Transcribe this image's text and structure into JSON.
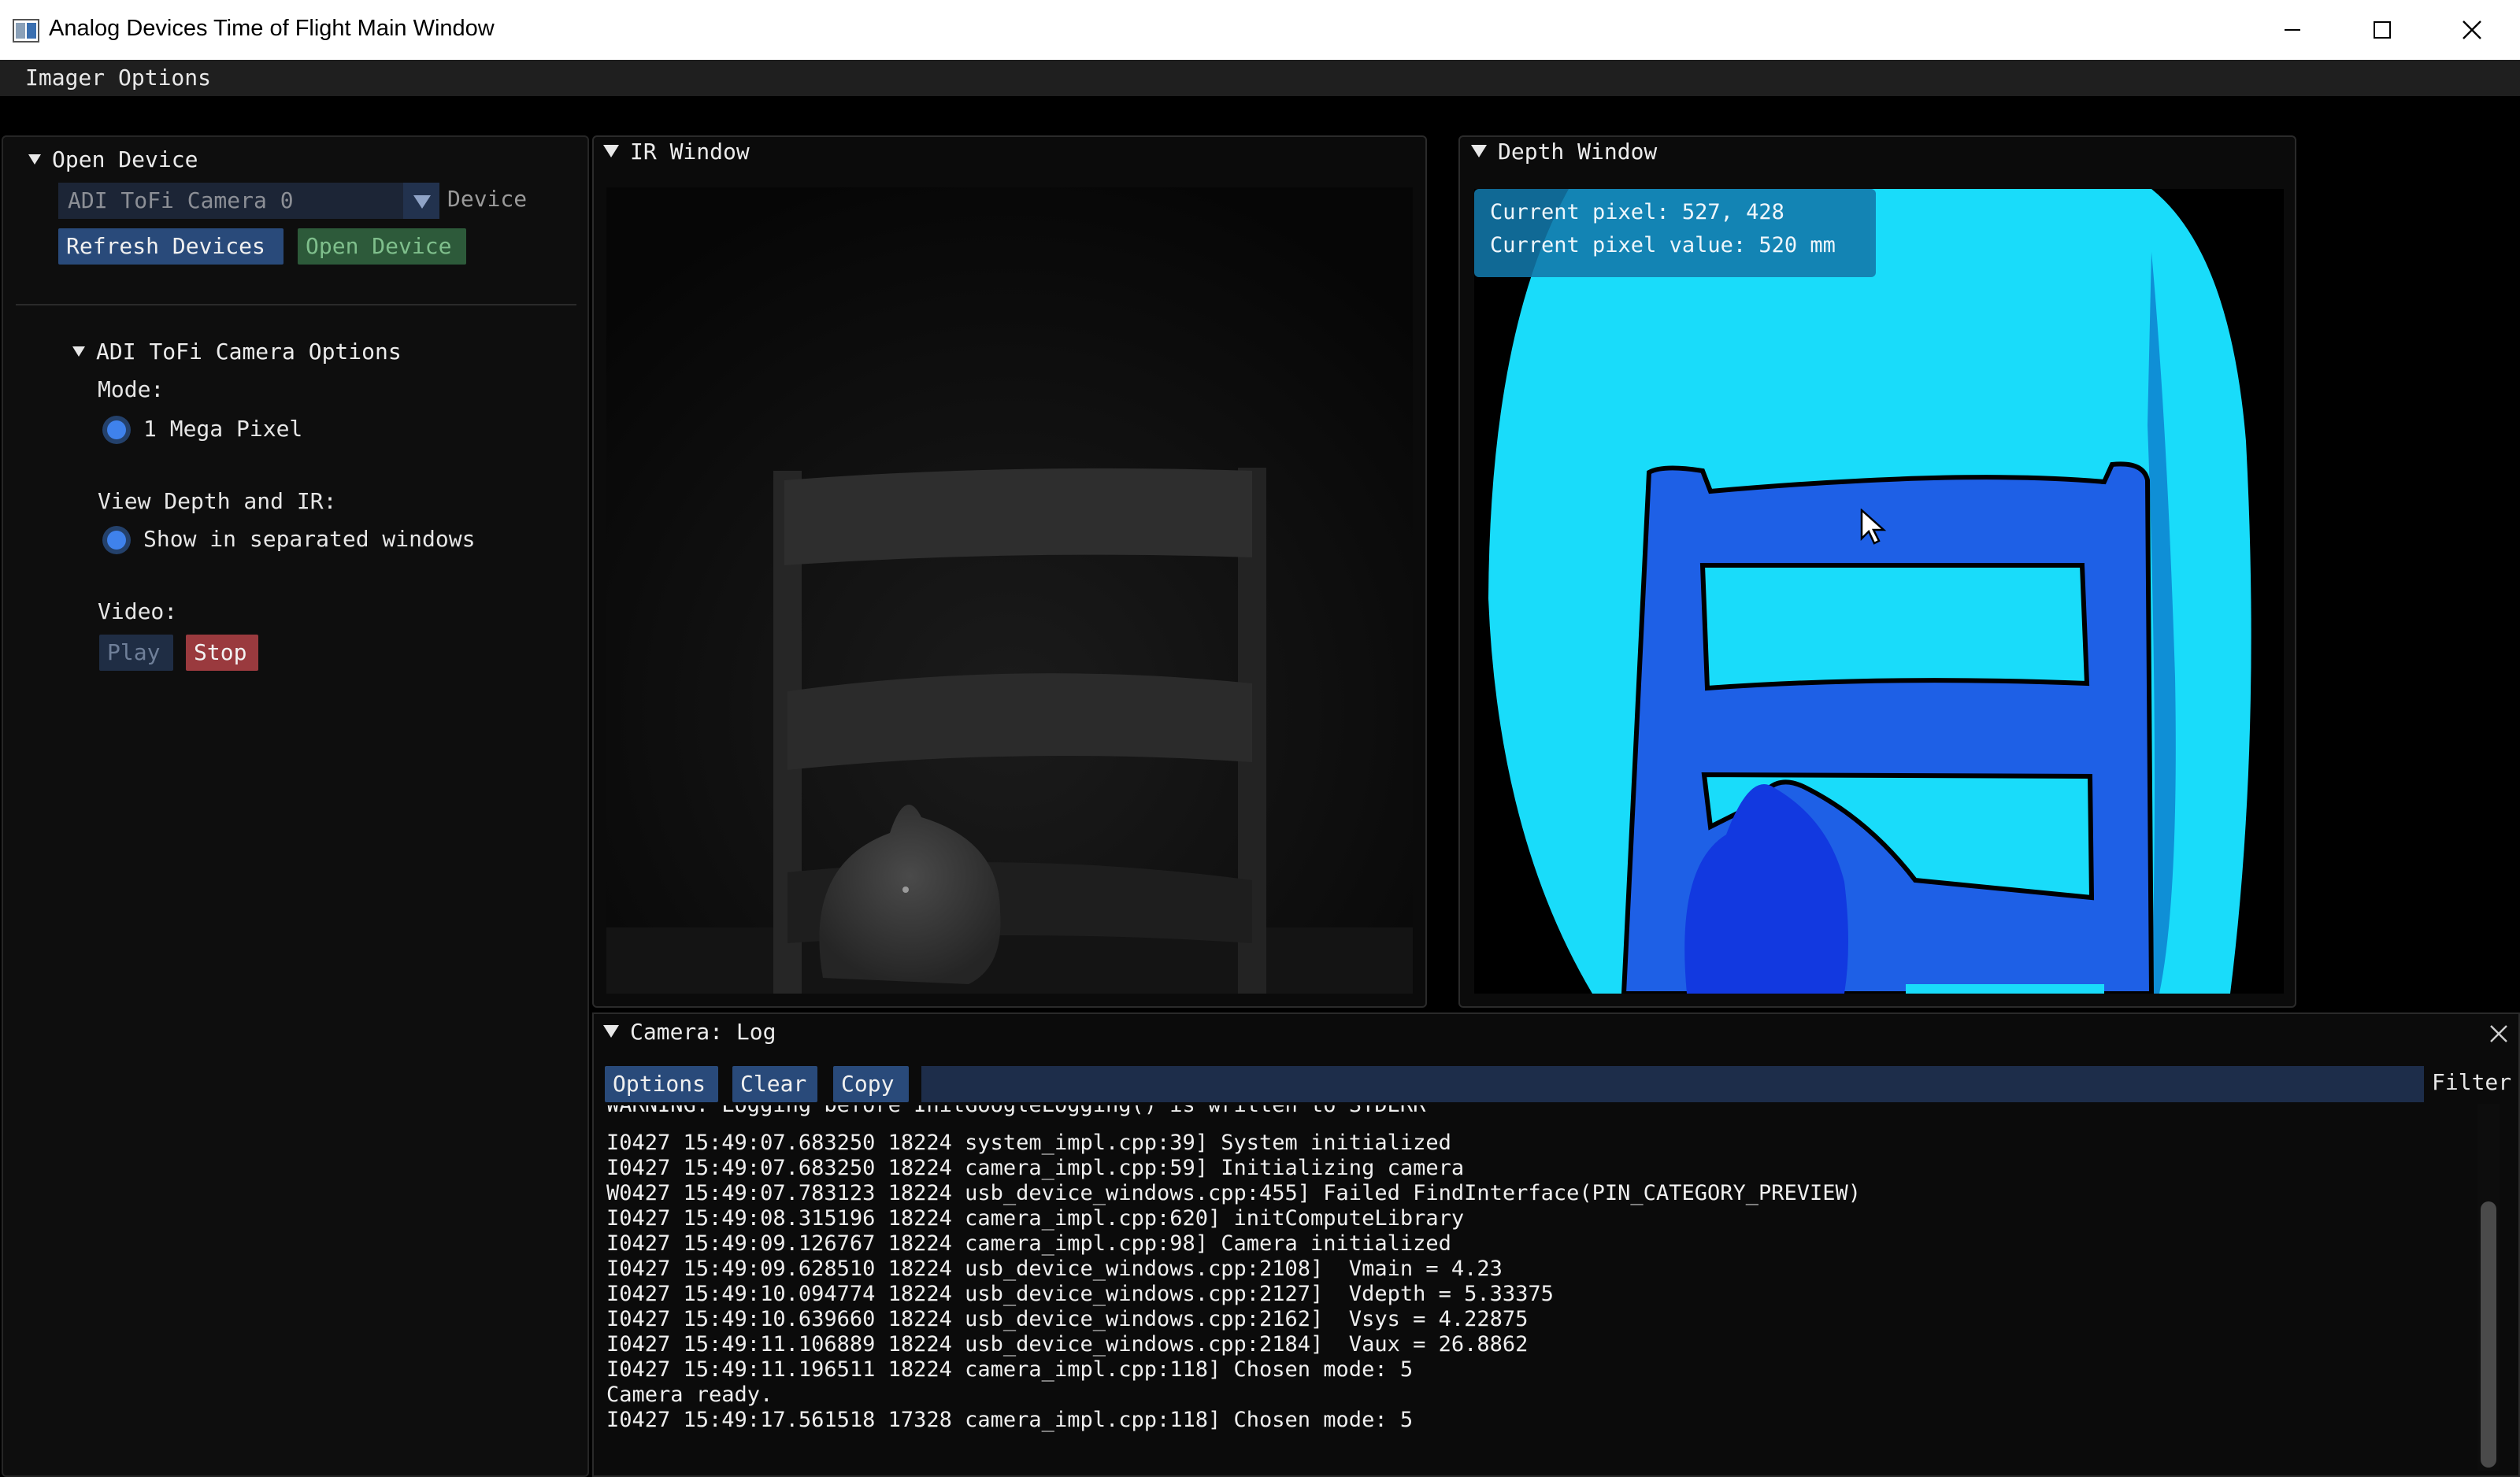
{
  "window": {
    "title": "Analog Devices Time of Flight Main Window"
  },
  "menubar": {
    "imager_options": "Imager Options"
  },
  "open_device": {
    "header": "Open Device",
    "device_value": "ADI ToFi Camera 0",
    "device_label": "Device",
    "refresh_label": "Refresh Devices",
    "open_label": "Open Device"
  },
  "camera_options": {
    "header": "ADI ToFi Camera Options",
    "mode_label": "Mode:",
    "mode_option": "1 Mega Pixel",
    "view_label": "View Depth and IR:",
    "view_option": "Show in separated windows",
    "video_label": "Video:",
    "play_label": "Play",
    "stop_label": "Stop"
  },
  "ir_window": {
    "title": "IR Window"
  },
  "depth_window": {
    "title": "Depth Window",
    "pixel_text": "Current pixel: 527, 428",
    "pixel_value_text": "Current pixel value: 520 mm"
  },
  "log": {
    "title": "Camera: Log",
    "options_label": "Options",
    "clear_label": "Clear",
    "copy_label": "Copy",
    "filter_label": "Filter",
    "filter_value": "",
    "clipped_line": "WARNING: Logging before InitGoogleLogging() is written to STDERR",
    "lines": [
      "I0427 15:49:07.683250 18224 system_impl.cpp:39] System initialized",
      "I0427 15:49:07.683250 18224 camera_impl.cpp:59] Initializing camera",
      "W0427 15:49:07.783123 18224 usb_device_windows.cpp:455] Failed FindInterface(PIN_CATEGORY_PREVIEW)",
      "I0427 15:49:08.315196 18224 camera_impl.cpp:620] initComputeLibrary",
      "I0427 15:49:09.126767 18224 camera_impl.cpp:98] Camera initialized",
      "I0427 15:49:09.628510 18224 usb_device_windows.cpp:2108]  Vmain = 4.23",
      "I0427 15:49:10.094774 18224 usb_device_windows.cpp:2127]  Vdepth = 5.33375",
      "I0427 15:49:10.639660 18224 usb_device_windows.cpp:2162]  Vsys = 4.22875",
      "I0427 15:49:11.106889 18224 usb_device_windows.cpp:2184]  Vaux = 26.8862",
      "I0427 15:49:11.196511 18224 camera_impl.cpp:118] Chosen mode: 5",
      "Camera ready.",
      "I0427 15:49:17.561518 17328 camera_impl.cpp:118] Chosen mode: 5"
    ]
  },
  "colors": {
    "button_blue": "#294a7a",
    "button_green": "#2d5a3a",
    "button_red": "#9a3a3e",
    "radio_blue": "#3f82ec",
    "depth_cyan": "#19dcfa",
    "depth_blue": "#1e60e6"
  },
  "icons": [
    "app-icon",
    "minimize-icon",
    "maximize-icon",
    "close-icon",
    "collapse-triangle-icon",
    "dropdown-arrow-icon",
    "mouse-cursor-icon"
  ]
}
